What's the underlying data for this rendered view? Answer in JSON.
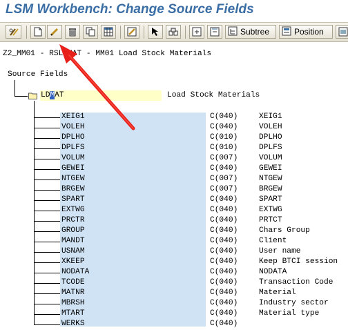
{
  "window": {
    "title": "LSM Workbench: Change Source Fields"
  },
  "toolbar": {
    "subtree_label": "Subtree",
    "position_label": "Position"
  },
  "header_line": "Z2_MM01 - RSLDMAT - MM01 Load Stock Materials",
  "tree": {
    "root_label": "Source Fields",
    "structure": {
      "name_prefix": "LD",
      "name_cursor": "M",
      "name_suffix": "AT",
      "description": "Load Stock Materials"
    },
    "fields": [
      {
        "name": "XEIG1",
        "type": "C(040)",
        "desc": "XEIG1"
      },
      {
        "name": "VOLEH",
        "type": "C(040)",
        "desc": "VOLEH"
      },
      {
        "name": "DPLHO",
        "type": "C(010)",
        "desc": "DPLHO"
      },
      {
        "name": "DPLFS",
        "type": "C(010)",
        "desc": "DPLFS"
      },
      {
        "name": "VOLUM",
        "type": "C(007)",
        "desc": "VOLUM"
      },
      {
        "name": "GEWEI",
        "type": "C(040)",
        "desc": "GEWEI"
      },
      {
        "name": "NTGEW",
        "type": "C(007)",
        "desc": "NTGEW"
      },
      {
        "name": "BRGEW",
        "type": "C(007)",
        "desc": "BRGEW"
      },
      {
        "name": "SPART",
        "type": "C(040)",
        "desc": "SPART"
      },
      {
        "name": "EXTWG",
        "type": "C(040)",
        "desc": "EXTWG"
      },
      {
        "name": "PRCTR",
        "type": "C(040)",
        "desc": "PRTCT"
      },
      {
        "name": "GROUP",
        "type": "C(040)",
        "desc": "Chars Group"
      },
      {
        "name": "MANDT",
        "type": "C(040)",
        "desc": "Client"
      },
      {
        "name": "USNAM",
        "type": "C(040)",
        "desc": "User name"
      },
      {
        "name": "XKEEP",
        "type": "C(040)",
        "desc": "Keep BTCI session"
      },
      {
        "name": "NODATA",
        "type": "C(040)",
        "desc": "NODATA"
      },
      {
        "name": "TCODE",
        "type": "C(040)",
        "desc": "Transaction Code"
      },
      {
        "name": "MATNR",
        "type": "C(040)",
        "desc": "Material"
      },
      {
        "name": "MBRSH",
        "type": "C(040)",
        "desc": "Industry sector"
      },
      {
        "name": "MTART",
        "type": "C(040)",
        "desc": "Material type"
      },
      {
        "name": "WERKS",
        "type": "C(040)",
        "desc": ""
      }
    ]
  },
  "icons": [
    "display-change-icon",
    "create-icon",
    "change-pencil-icon",
    "delete-icon",
    "copy-icon",
    "table-icon",
    "edit-pencil-icon",
    "cursor-select-icon",
    "find-icon",
    "expand-subtree-icon",
    "collapse-subtree-icon",
    "subtree-icon",
    "position-icon",
    "more-icon"
  ],
  "colors": {
    "title": "#3a6ea5",
    "row_highlight": "#cfe3f5",
    "root_highlight": "#ffffc8",
    "annotation_arrow": "#e8201a"
  }
}
